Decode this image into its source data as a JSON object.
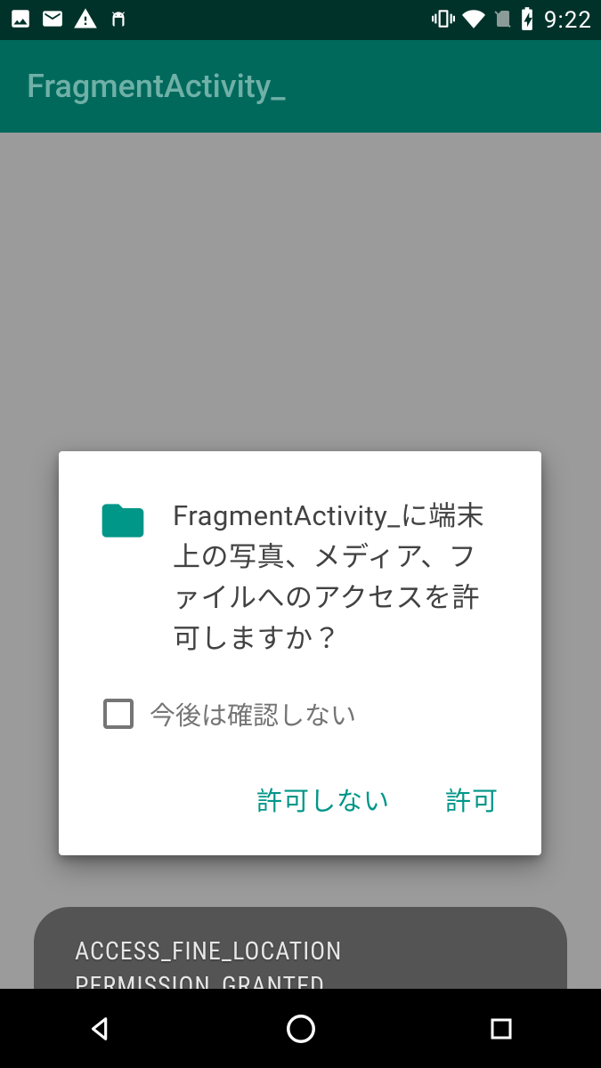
{
  "status": {
    "time": "9:22"
  },
  "appbar": {
    "title": "FragmentActivity_"
  },
  "dialog": {
    "message": "FragmentActivity_に端末上の写真、メディア、ファイルへのアクセスを許可しますか？",
    "dont_ask_label": "今後は確認しない",
    "deny": "許可しない",
    "allow": "許可"
  },
  "toast": {
    "line1": "ACCESS_FINE_LOCATION",
    "line2": "PERMISSION_GRANTED"
  }
}
